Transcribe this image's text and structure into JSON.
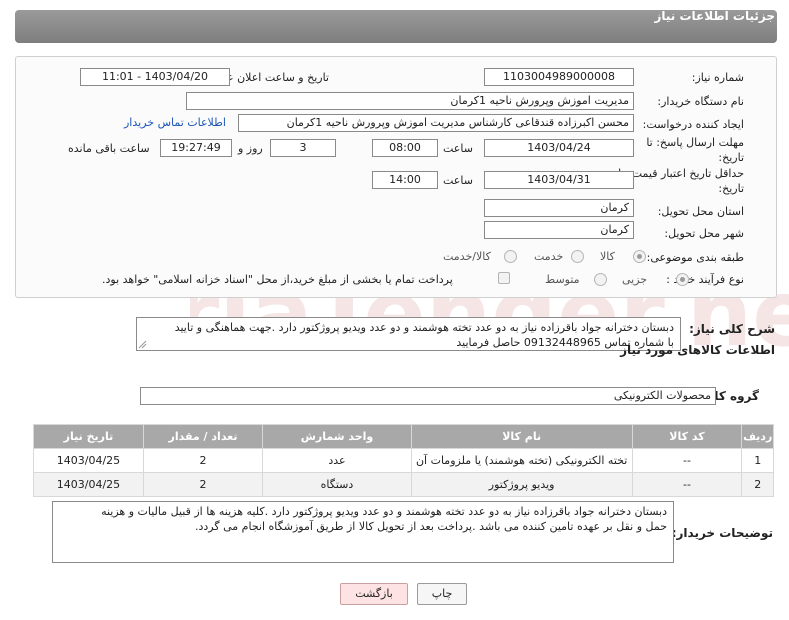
{
  "header": {
    "title": "جزئیات اطلاعات نیاز"
  },
  "form": {
    "need_number_label": "شماره نیاز:",
    "need_number": "1103004989000008",
    "announce_label": "تاریخ و ساعت اعلان عمومی:",
    "announce_value": "1403/04/20 - 11:01",
    "buyer_org_label": "نام دستگاه خریدار:",
    "buyer_org": "مدیریت اموزش وپرورش ناحیه 1کرمان",
    "creator_label": "ایجاد کننده درخواست:",
    "creator": "محسن اکبرزاده قندقاعی کارشناس  مدیریت اموزش وپرورش ناحیه 1کرمان",
    "buyer_contact_link": "اطلاعات تماس خریدار",
    "deadline_label_1": "مهلت ارسال پاسخ: تا",
    "deadline_label_2": "تاریخ:",
    "deadline_date": "1403/04/24",
    "time_label": "ساعت",
    "deadline_time": "08:00",
    "days_value": "3",
    "days_label": "روز و",
    "remaining_time": "19:27:49",
    "remaining_label": "ساعت باقی مانده",
    "validity_label_1": "حداقل تاریخ اعتبار قیمت: تا",
    "validity_label_2": "تاریخ:",
    "validity_date": "1403/04/31",
    "validity_time": "14:00",
    "province_label": "استان محل تحویل:",
    "province": "کرمان",
    "city_label": "شهر محل تحویل:",
    "city": "کرمان",
    "category_label": "طبقه بندی موضوعی:",
    "category_options": [
      "کالا",
      "خدمت",
      "کالا/خدمت"
    ],
    "category_selected": "کالا",
    "process_label": "نوع فرآیند خرید :",
    "process_options": [
      "جزیی",
      "متوسط"
    ],
    "process_selected": "جزیی",
    "payment_note": "پرداخت تمام یا بخشی از مبلغ خرید،از محل \"اسناد خزانه اسلامی\" خواهد بود."
  },
  "description": {
    "label": "شرح کلی نیاز:",
    "line1": "دبستان دخترانه جواد باقرزاده نیاز به دو عدد تخته هوشمند و دو عدد ویدیو پروژکتور دارد .جهت هماهنگی و تایید",
    "line2": "با شماره تماس 09132448965 حاصل فرمایید"
  },
  "goods": {
    "section_title": "اطلاعات کالاهای مورد نیاز",
    "group_label": "گروه کالا:",
    "group_value": "محصولات الکترونیکی",
    "columns": [
      "ردیف",
      "کد کالا",
      "نام کالا",
      "واحد شمارش",
      "تعداد / مقدار",
      "تاریخ نیاز"
    ],
    "rows": [
      {
        "row": "1",
        "code": "--",
        "name": "تخته الکترونیکی (تخته هوشمند) یا ملزومات آن",
        "unit": "عدد",
        "qty": "2",
        "date": "1403/04/25"
      },
      {
        "row": "2",
        "code": "--",
        "name": "ویدیو پروژکتور",
        "unit": "دستگاه",
        "qty": "2",
        "date": "1403/04/25"
      }
    ]
  },
  "buyer_notes": {
    "label": "توضیحات خریدار:",
    "line1": "دبستان دخترانه جواد باقرزاده نیاز به دو عدد تخته هوشمند و دو عدد ویدیو پروژکتور دارد .کلیه هزینه ها از قبیل مالیات و هزینه",
    "line2": "حمل و نقل بر عهده تامین کننده می باشد .پرداخت بعد از تحویل کالا از طریق آموزشگاه انجام می گردد."
  },
  "buttons": {
    "print": "چاپ",
    "back": "بازگشت"
  },
  "watermark": {
    "text": "AriaTender.neT"
  }
}
